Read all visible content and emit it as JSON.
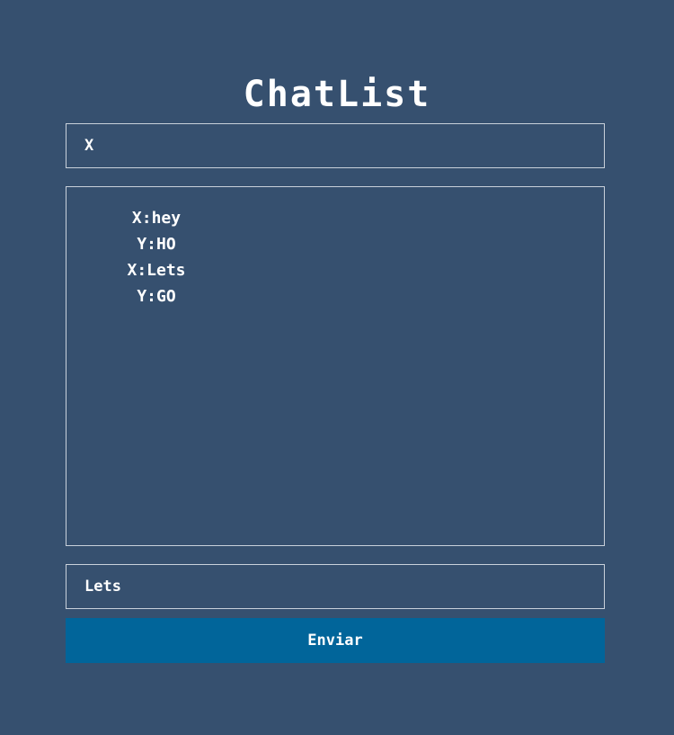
{
  "app": {
    "title": "ChatList"
  },
  "name_field": {
    "value": "X"
  },
  "chat": {
    "messages": [
      "X:hey",
      "Y:HO",
      "X:Lets",
      "Y:GO"
    ]
  },
  "message_field": {
    "value": "Lets"
  },
  "send_button": {
    "label": "Enviar"
  },
  "colors": {
    "background": "#36506f",
    "button": "#01659a",
    "border": "#c9d1db",
    "text": "#ffffff"
  }
}
